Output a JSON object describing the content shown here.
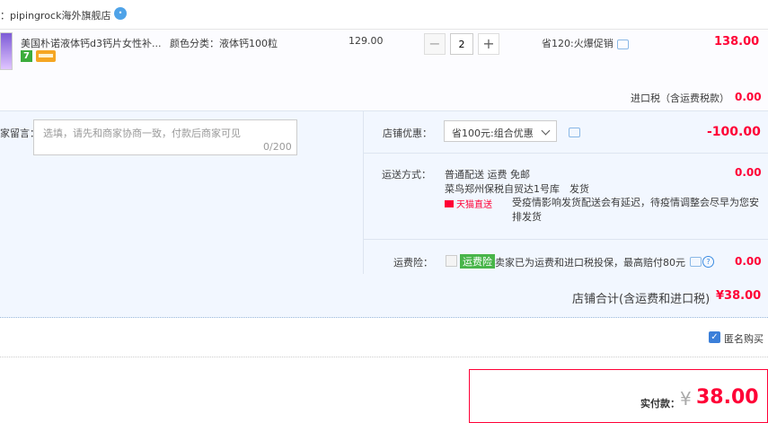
{
  "shop": {
    "name": "：pipingrock海外旗舰店",
    "ww_icon": "wangwang-icon"
  },
  "item": {
    "title": "美国朴诺液体钙d3钙片女性补...",
    "badge_7": "7",
    "sku": "颜色分类：液体钙100粒",
    "unit_price": "129.00",
    "quantity": "2",
    "minus_label": "−",
    "plus_label": "+",
    "promo": "省120:火爆促销",
    "subtotal": "138.00"
  },
  "import_tax": {
    "label": "进口税（含运费税款）",
    "value": "0.00"
  },
  "memo": {
    "label": "家留言：",
    "placeholder": "选填，请先和商家协商一致，付款后商家可见",
    "count": "0/200"
  },
  "coupon": {
    "label": "店铺优惠：",
    "selected": "省100元:组合优惠",
    "value": "-100.00"
  },
  "shipping": {
    "label": "运送方式：",
    "line1": "普通配送 运费 免邮",
    "line2": "菜鸟郑州保税自贸达1号库　发货",
    "tmall_tag": "天猫直送",
    "note": "受疫情影响发货配送会有延迟，待疫情调整会尽早为您安排发货",
    "value": "0.00"
  },
  "insurance": {
    "label": "运费险：",
    "tag": "运费险",
    "text": "卖家已为运费和进口税投保，最高赔付80元",
    "help": "?",
    "value": "0.00"
  },
  "store_total": {
    "label": "店铺合计(含运费和进口税)",
    "value": "¥38.00"
  },
  "anonymous": {
    "label": "匿名购买",
    "checked": true,
    "check_mark": "✓"
  },
  "payment": {
    "label": "实付款：",
    "currency": "¥",
    "amount": "38.00"
  },
  "colors": {
    "accent_red": "#ff0036",
    "band_bg": "#f2f7ff",
    "link_blue": "#3b7fd9"
  }
}
